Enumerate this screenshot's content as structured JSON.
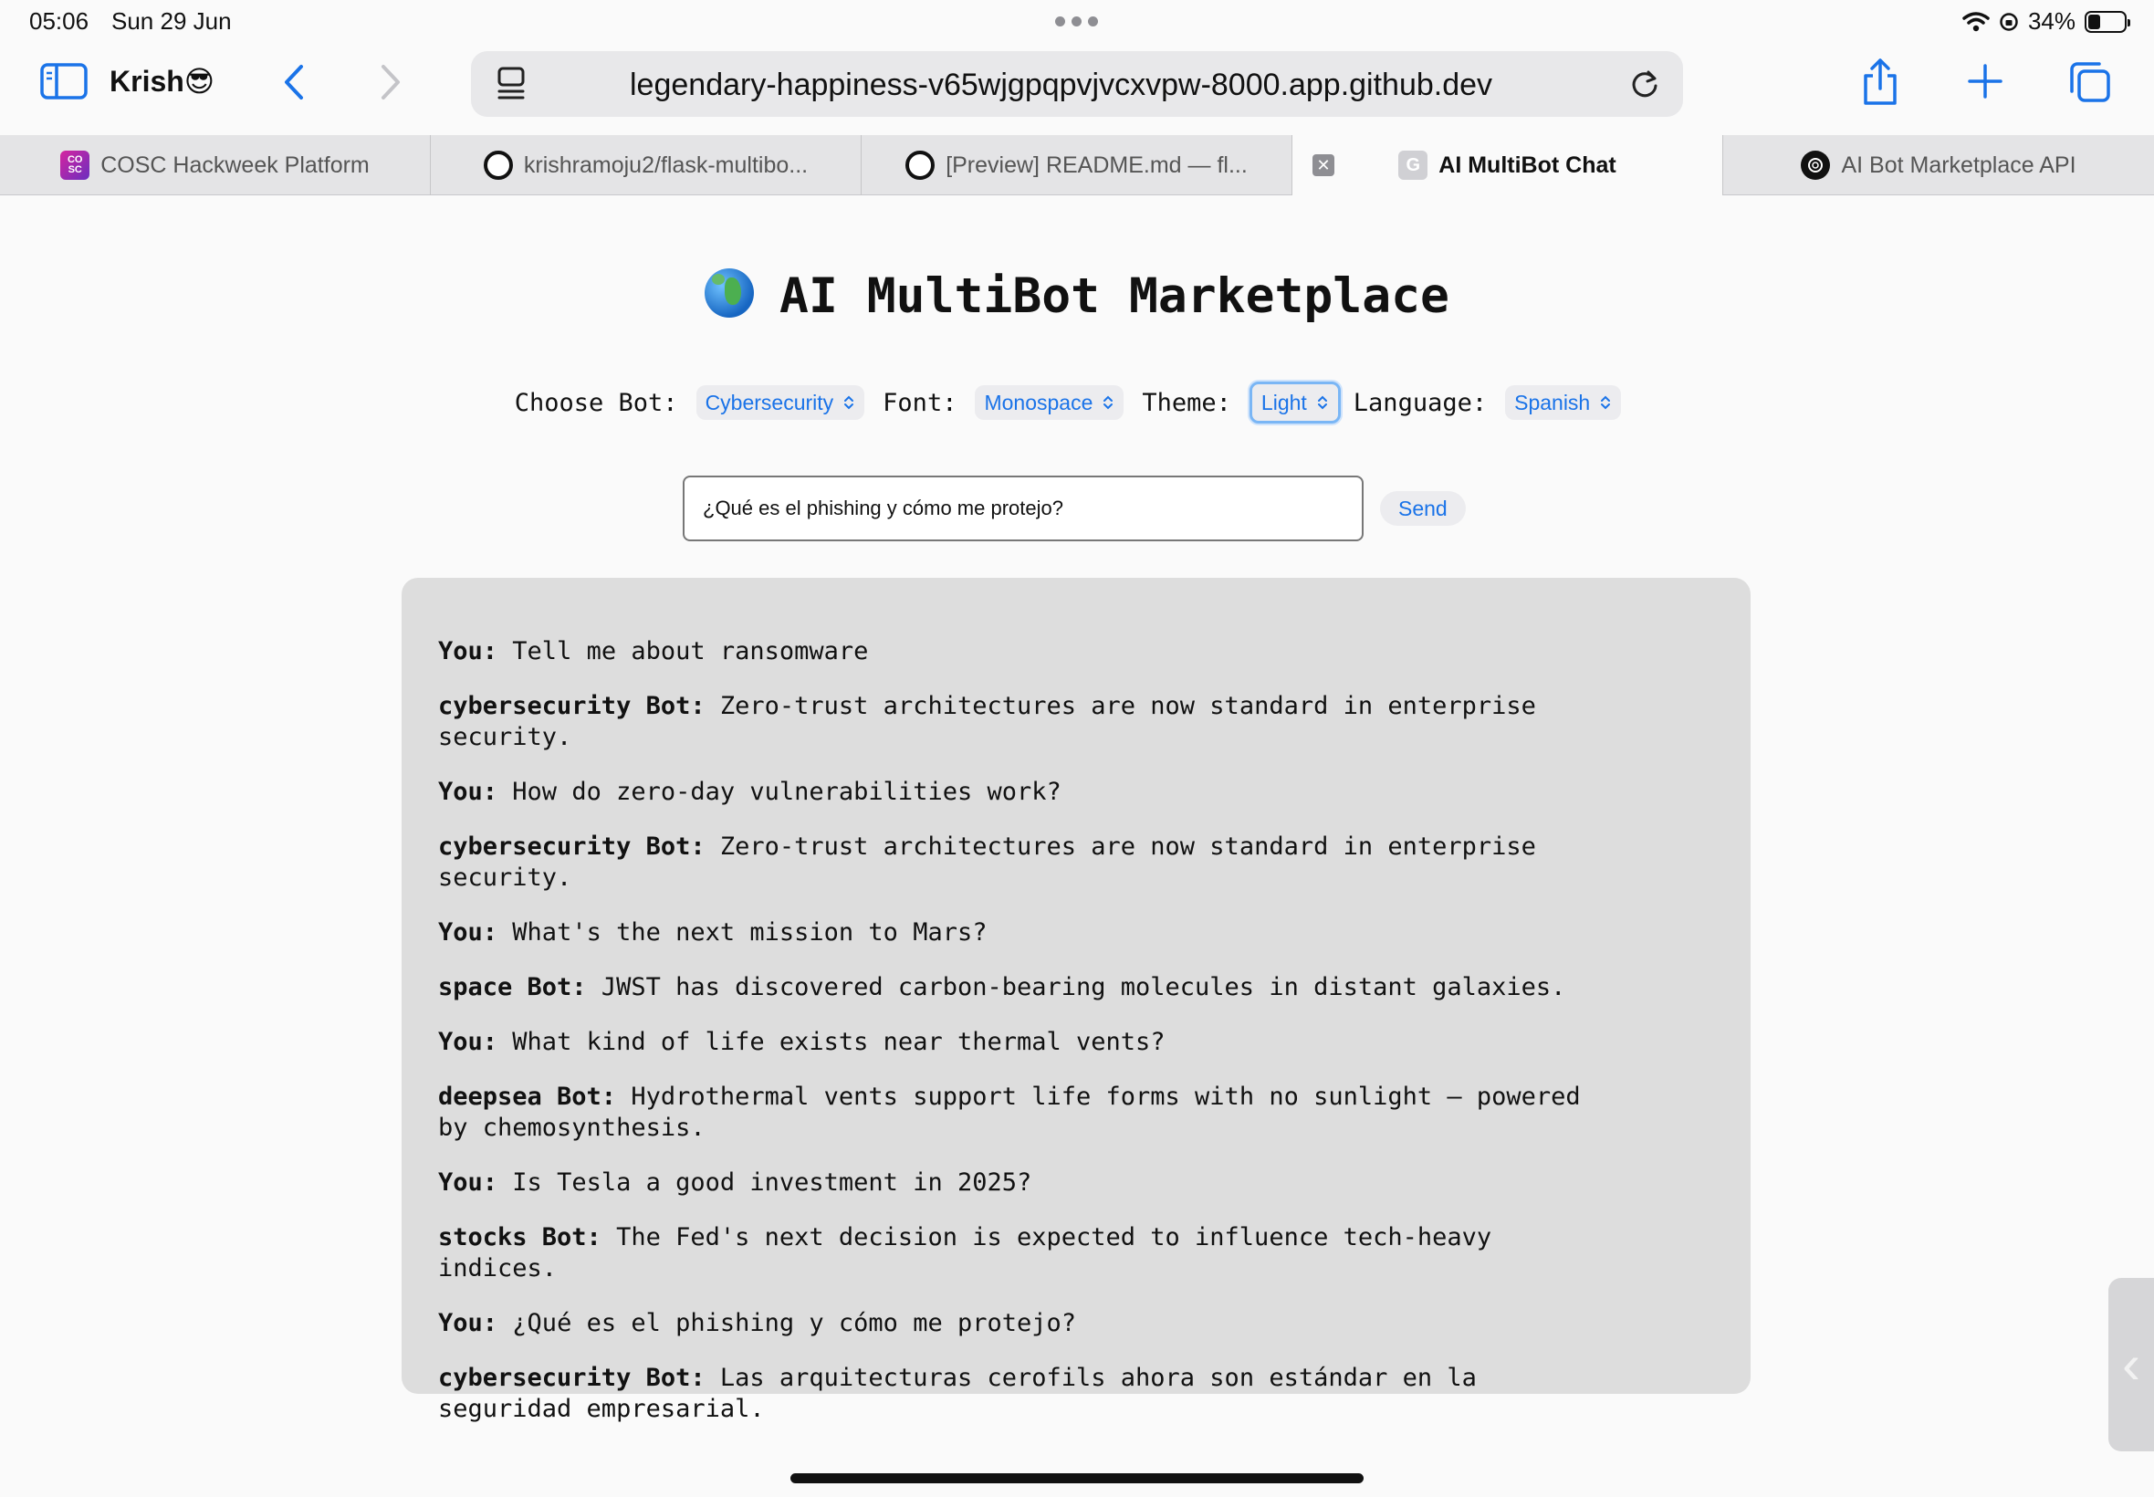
{
  "status": {
    "time": "05:06",
    "date": "Sun 29 Jun",
    "battery": "34%",
    "battery_level": 0.34
  },
  "toolbar": {
    "profile_name": "Krish😎",
    "url": "legendary-happiness-v65wjgpqpvjvcxvpw-8000.app.github.dev"
  },
  "tabs": [
    {
      "label": "COSC Hackweek Platform",
      "favicon": "cosc-icon"
    },
    {
      "label": "krishramoju2/flask-multibo...",
      "favicon": "github-icon"
    },
    {
      "label": "[Preview] README.md — fl...",
      "favicon": "github-icon"
    },
    {
      "label": "AI MultiBot Chat",
      "favicon": "g-icon",
      "active": true
    },
    {
      "label": "AI Bot Marketplace API",
      "favicon": "openai-icon"
    }
  ],
  "page": {
    "title": "AI MultiBot Marketplace",
    "controls": {
      "bot_label": "Choose Bot:",
      "bot_value": "Cybersecurity",
      "font_label": "Font:",
      "font_value": "Monospace",
      "theme_label": "Theme:",
      "theme_value": "Light",
      "language_label": "Language:",
      "language_value": "Spanish"
    },
    "input_value": "¿Qué es el phishing y cómo me protejo?",
    "send_label": "Send"
  },
  "messages": [
    {
      "speaker": "You:",
      "text": "Tell me about ransomware"
    },
    {
      "speaker": "cybersecurity Bot:",
      "text": "Zero-trust architectures are now standard in enterprise security."
    },
    {
      "speaker": "You:",
      "text": "How do zero-day vulnerabilities work?"
    },
    {
      "speaker": "cybersecurity Bot:",
      "text": "Zero-trust architectures are now standard in enterprise security."
    },
    {
      "speaker": "You:",
      "text": "What's the next mission to Mars?"
    },
    {
      "speaker": "space Bot:",
      "text": "JWST has discovered carbon-bearing molecules in distant galaxies."
    },
    {
      "speaker": "You:",
      "text": "What kind of life exists near thermal vents?"
    },
    {
      "speaker": "deepsea Bot:",
      "text": "Hydrothermal vents support life forms with no sunlight — powered by chemosynthesis."
    },
    {
      "speaker": "You:",
      "text": "Is Tesla a good investment in 2025?"
    },
    {
      "speaker": "stocks Bot:",
      "text": "The Fed's next decision is expected to influence tech-heavy indices."
    },
    {
      "speaker": "You:",
      "text": "¿Qué es el phishing y cómo me protejo?"
    },
    {
      "speaker": "cybersecurity Bot:",
      "text": "Las arquitecturas cerofils ahora son estándar en la seguridad empresarial."
    }
  ],
  "colors": {
    "accent": "#1a73e8",
    "chat_bg": "#dddddd",
    "page_bg": "#fafafa"
  }
}
